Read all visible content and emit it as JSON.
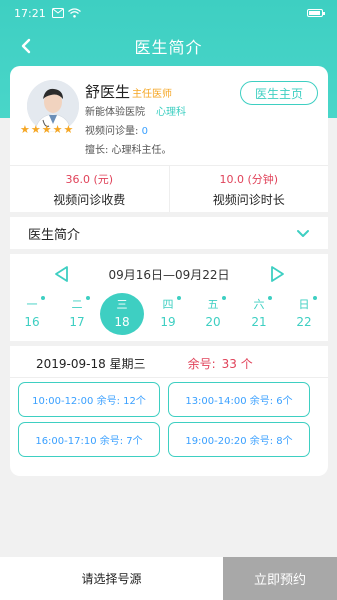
{
  "status_bar": {
    "time": "17:21"
  },
  "nav": {
    "title": "医生简介"
  },
  "doctor": {
    "name": "舒医生",
    "title": "主任医师",
    "hospital": "新能体验医院",
    "department": "心理科",
    "consult_label": "视频问诊量: ",
    "consult_count": "0",
    "specialty": "擅长: 心理科主任。",
    "rating": 5,
    "home_button": "医生主页"
  },
  "fees": {
    "fee_value": "36.0 (元)",
    "fee_label": "视频问诊收费",
    "duration_value": "10.0 (分钟)",
    "duration_label": "视频问诊时长"
  },
  "intro": {
    "label": "医生简介"
  },
  "week": {
    "range": "09月16日—09月22日"
  },
  "days": [
    {
      "dow": "一",
      "num": "16",
      "selected": false
    },
    {
      "dow": "二",
      "num": "17",
      "selected": false
    },
    {
      "dow": "三",
      "num": "18",
      "selected": true
    },
    {
      "dow": "四",
      "num": "19",
      "selected": false
    },
    {
      "dow": "五",
      "num": "20",
      "selected": false
    },
    {
      "dow": "六",
      "num": "21",
      "selected": false
    },
    {
      "dow": "日",
      "num": "22",
      "selected": false
    }
  ],
  "selected_date": {
    "date": "2019-09-18 星期三",
    "remain_label": "余号:",
    "remain_value": "33 个"
  },
  "slots": [
    {
      "label": "10:00-12:00 余号: 12个"
    },
    {
      "label": "13:00-14:00 余号: 6个"
    },
    {
      "label": "16:00-17:10 余号: 7个"
    },
    {
      "label": "19:00-20:20 余号: 8个"
    }
  ],
  "bottom": {
    "select_label": "请选择号源",
    "book_label": "立即预约"
  },
  "colors": {
    "accent": "#3ecfc2",
    "price": "#e0435a",
    "link": "#3aa0ff",
    "star": "#f5a623"
  }
}
